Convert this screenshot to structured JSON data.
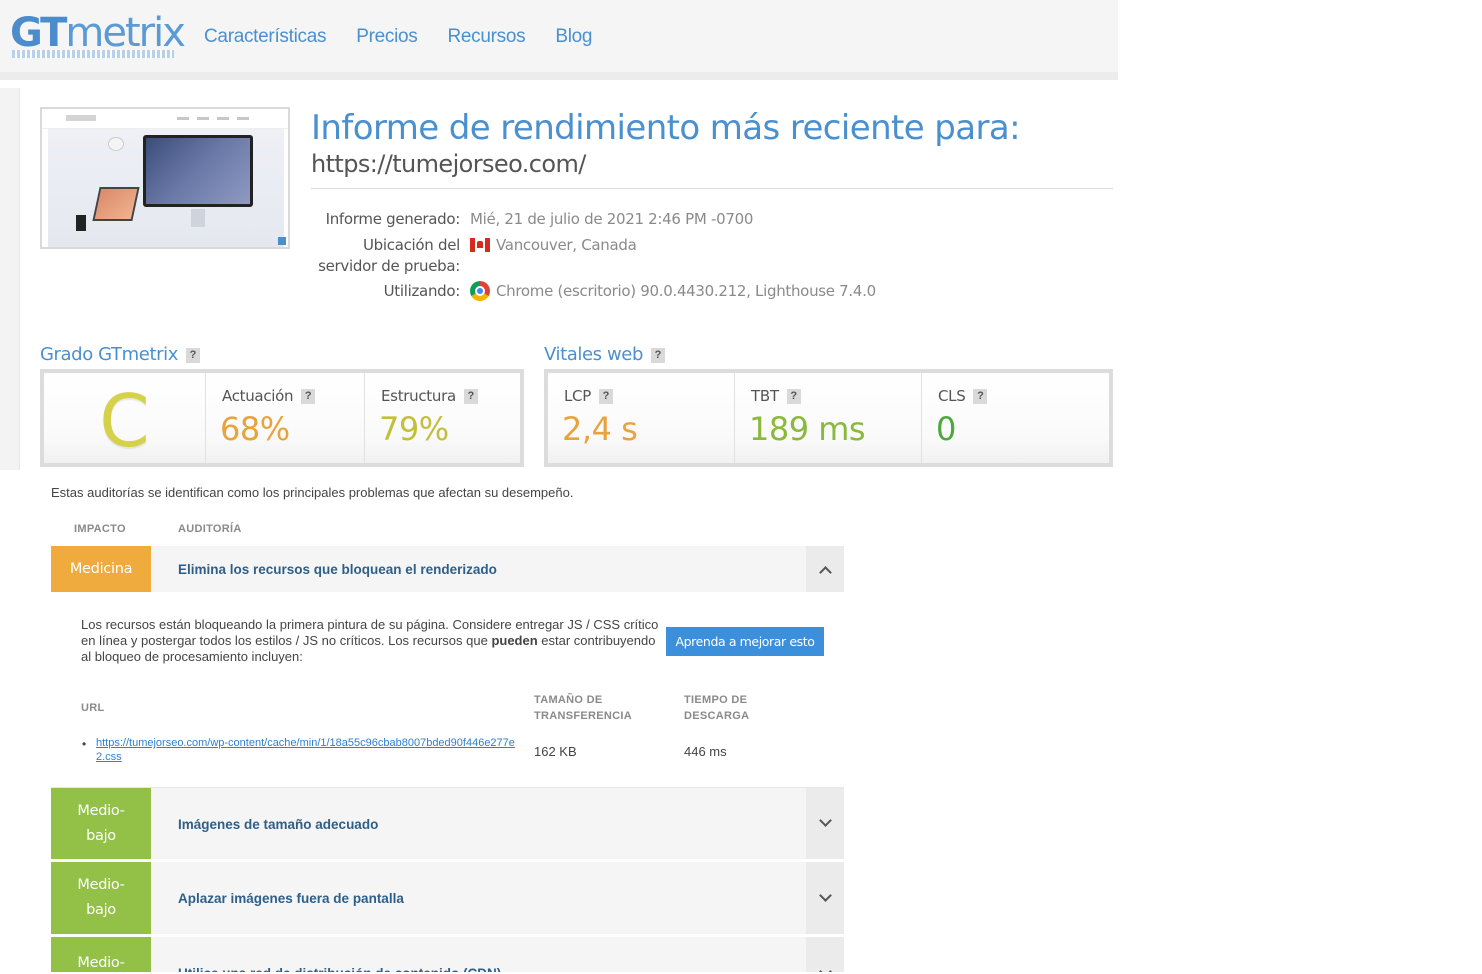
{
  "header": {
    "logo_gt": "GT",
    "logo_rest": "metrix",
    "nav": [
      "Características",
      "Precios",
      "Recursos",
      "Blog"
    ]
  },
  "report": {
    "title": "Informe de rendimiento más reciente para:",
    "url": "https://tumejorseo.com/",
    "generated_label": "Informe generado:",
    "generated_value": "Mié, 21 de julio de 2021 2:46 PM -0700",
    "location_label_1": "Ubicación del",
    "location_label_2": "servidor de prueba:",
    "location_value": "Vancouver, Canada",
    "using_label": "Utilizando:",
    "using_value": "Chrome (escritorio) 90.0.4430.212, Lighthouse 7.4.0",
    "flag_icon": "canada-flag-icon",
    "browser_icon": "chrome-icon"
  },
  "grade": {
    "title": "Grado GTmetrix",
    "letter": "C",
    "performance_label": "Actuación",
    "performance_value": "68%",
    "structure_label": "Estructura",
    "structure_value": "79%"
  },
  "vitals": {
    "title": "Vitales web",
    "lcp_label": "LCP",
    "lcp_value": "2,4 s",
    "tbt_label": "TBT",
    "tbt_value": "189 ms",
    "cls_label": "CLS",
    "cls_value": "0"
  },
  "help_mark": "?",
  "audits": {
    "intro": "Estas auditorías se identifican como los principales problemas que afectan su desempeño.",
    "col_impact": "IMPACTO",
    "col_audit": "AUDITORÍA",
    "items": [
      {
        "impact": "Medicina",
        "title": "Elimina los recursos que bloquean el renderizado",
        "expanded": true
      },
      {
        "impact": "Medio-bajo",
        "impact_1": "Medio-",
        "impact_2": "bajo",
        "title": "Imágenes de tamaño adecuado",
        "expanded": false
      },
      {
        "impact": "Medio-bajo",
        "impact_1": "Medio-",
        "impact_2": "bajo",
        "title": "Aplazar imágenes fuera de pantalla",
        "expanded": false
      },
      {
        "impact": "Medio-",
        "title": "Utilice una red de distribución de contenido (CDN)",
        "expanded": false
      }
    ],
    "detail": {
      "text_before": "Los recursos están bloqueando la primera pintura de su página. Considere entregar JS / CSS crítico en línea y postergar todos los estilos / JS no críticos. Los recursos que ",
      "text_bold": "pueden",
      "text_after": " estar contribuyendo al bloqueo de procesamiento incluyen:",
      "button": "Aprenda a mejorar esto",
      "th_url": "URL",
      "th_size_1": "TAMAÑO DE",
      "th_size_2": "TRANSFERENCIA",
      "th_time_1": "TIEMPO DE",
      "th_time_2": "DESCARGA",
      "resource_url": "https://tumejorseo.com/wp-content/cache/min/1/18a55c96cbab8007bded90f446e277e2.css",
      "size": "162 KB",
      "time": "446 ms"
    }
  },
  "colors": {
    "brand_blue": "#4a90cf",
    "grade_c": "#d6d14a",
    "orange": "#e9a33c",
    "yellow_green": "#b9b73a",
    "green": "#8bb93d",
    "cls_green": "#4caa3a",
    "impact_orange": "#f0ab3e",
    "impact_green": "#93c047"
  }
}
